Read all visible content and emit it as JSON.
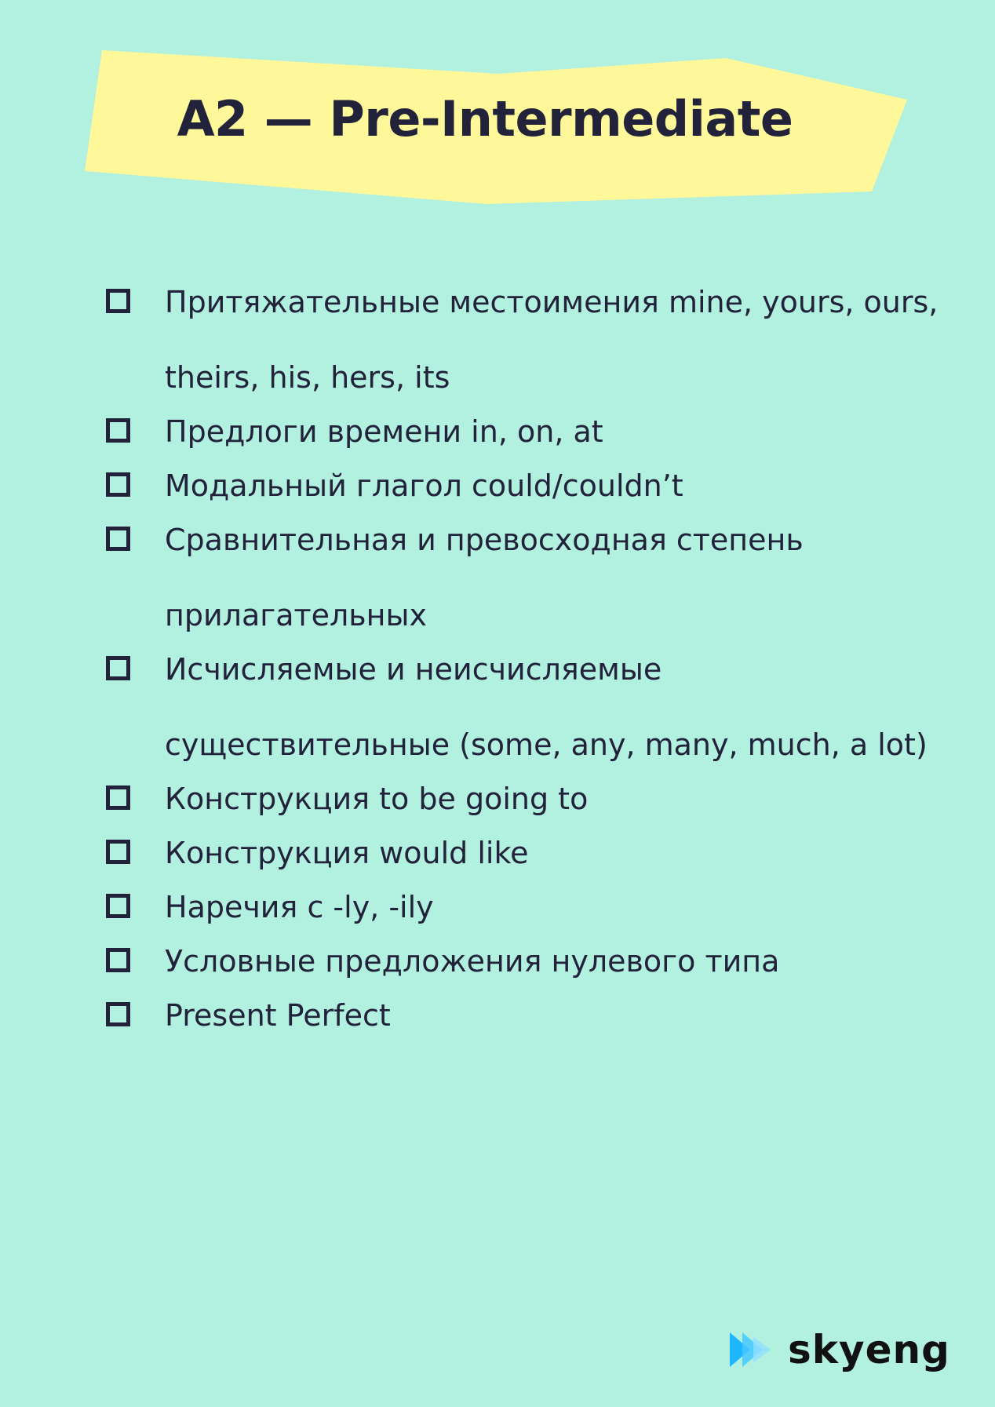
{
  "header": {
    "title": "A2 — Pre-Intermediate"
  },
  "checklist": {
    "items": [
      {
        "label": "Притяжательные местоимения mine, yours, ours, theirs, his, hers, its",
        "checked": false
      },
      {
        "label": "Предлоги времени in, on, at",
        "checked": false
      },
      {
        "label": "Модальный глагол could/couldn’t",
        "checked": false
      },
      {
        "label": "Сравнительная и превосходная степень прилагательных",
        "checked": false
      },
      {
        "label": "Исчисляемые и неисчисляемые существительные (some, any, many, much, a lot)",
        "checked": false
      },
      {
        "label": "Конструкция to be going to",
        "checked": false
      },
      {
        "label": "Конструкция would like",
        "checked": false
      },
      {
        "label": "Наречия с -ly, -ily",
        "checked": false
      },
      {
        "label": "Условные предложения нулевого типа",
        "checked": false
      },
      {
        "label": "Present Perfect",
        "checked": false
      }
    ]
  },
  "brand": {
    "name": "skyeng",
    "icon": "play-arrows-icon"
  },
  "colors": {
    "background": "#b2f0e0",
    "banner": "#fef89a",
    "text": "#22223a",
    "logo_blue": "#1fb6ff"
  }
}
